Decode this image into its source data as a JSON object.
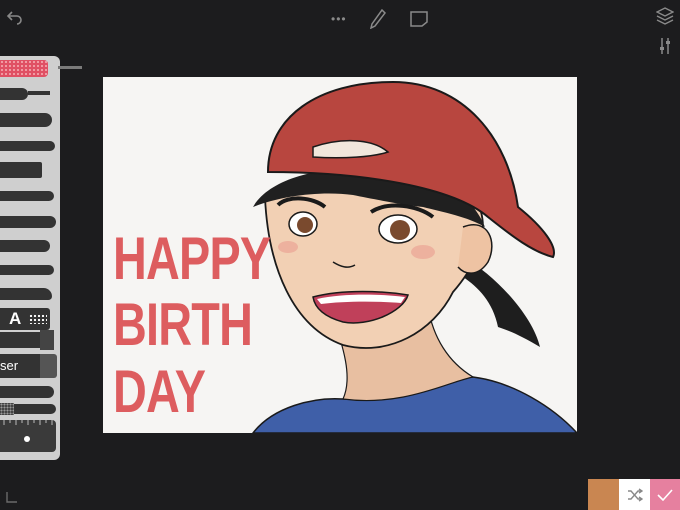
{
  "toolbar": {
    "more_glyph": "•••"
  },
  "canvas": {
    "text_lines": [
      "HAPPY",
      "BIRTH",
      "DAY"
    ]
  },
  "tool_panel": {
    "text_tool_label": "A",
    "eraser_label": "ser"
  },
  "colors": {
    "accent_text": "#dd5d5f",
    "swatch_primary": "#c98651",
    "swatch_secondary": "#ffffff",
    "confirm": "#e6809f"
  },
  "icons": [
    "undo-icon",
    "more-icon",
    "pen-icon",
    "paper-icon",
    "layers-icon",
    "adjust-icon",
    "shuffle-icon",
    "check-icon",
    "corner-icon"
  ]
}
